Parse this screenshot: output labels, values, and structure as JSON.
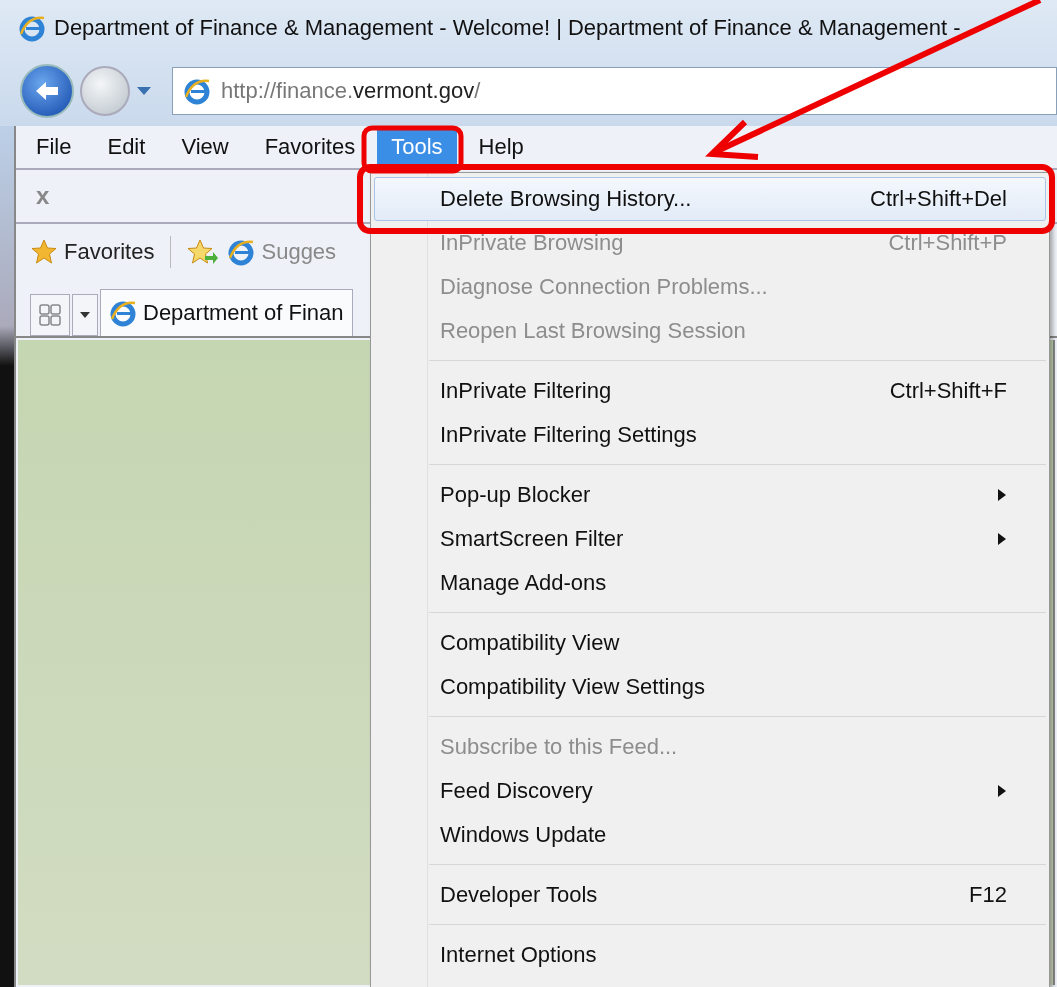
{
  "window": {
    "title": "Department of Finance & Management - Welcome! | Department of Finance & Management -"
  },
  "address": {
    "prefix": "http://finance.",
    "domain": "vermont.gov",
    "suffix": "/"
  },
  "menu_bar": [
    {
      "label": "File",
      "selected": false
    },
    {
      "label": "Edit",
      "selected": false
    },
    {
      "label": "View",
      "selected": false
    },
    {
      "label": "Favorites",
      "selected": false
    },
    {
      "label": "Tools",
      "selected": true
    },
    {
      "label": "Help",
      "selected": false
    }
  ],
  "command_bar": {
    "close": "x"
  },
  "favorites_bar": {
    "favorites": "Favorites",
    "suggested": "Sugges"
  },
  "tab": {
    "label": "Department of Finan"
  },
  "tools_menu": [
    [
      {
        "label": "Delete Browsing History...",
        "shortcut": "Ctrl+Shift+Del",
        "disabled": false,
        "submenu": false,
        "selected": true
      },
      {
        "label": "InPrivate Browsing",
        "shortcut": "Ctrl+Shift+P",
        "disabled": true,
        "submenu": false,
        "selected": false
      },
      {
        "label": "Diagnose Connection Problems...",
        "disabled": true,
        "submenu": false,
        "selected": false
      },
      {
        "label": "Reopen Last Browsing Session",
        "disabled": true,
        "submenu": false,
        "selected": false
      }
    ],
    [
      {
        "label": "InPrivate Filtering",
        "shortcut": "Ctrl+Shift+F",
        "disabled": false,
        "submenu": false,
        "selected": false
      },
      {
        "label": "InPrivate Filtering Settings",
        "disabled": false,
        "submenu": false,
        "selected": false
      }
    ],
    [
      {
        "label": "Pop-up Blocker",
        "disabled": false,
        "submenu": true,
        "selected": false
      },
      {
        "label": "SmartScreen Filter",
        "disabled": false,
        "submenu": true,
        "selected": false
      },
      {
        "label": "Manage Add-ons",
        "disabled": false,
        "submenu": false,
        "selected": false
      }
    ],
    [
      {
        "label": "Compatibility View",
        "disabled": false,
        "submenu": false,
        "selected": false
      },
      {
        "label": "Compatibility View Settings",
        "disabled": false,
        "submenu": false,
        "selected": false
      }
    ],
    [
      {
        "label": "Subscribe to this Feed...",
        "disabled": true,
        "submenu": false,
        "selected": false
      },
      {
        "label": "Feed Discovery",
        "disabled": false,
        "submenu": true,
        "selected": false
      },
      {
        "label": "Windows Update",
        "disabled": false,
        "submenu": false,
        "selected": false
      }
    ],
    [
      {
        "label": "Developer Tools",
        "shortcut": "F12",
        "disabled": false,
        "submenu": false,
        "selected": false
      }
    ],
    [
      {
        "label": "Internet Options",
        "disabled": false,
        "submenu": false,
        "selected": false
      }
    ]
  ]
}
